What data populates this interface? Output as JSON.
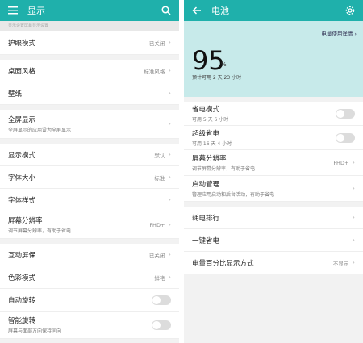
{
  "left": {
    "title": "显示",
    "strip_text": "显示设置屏幕显示设置",
    "items": [
      {
        "label": "护眼模式",
        "value": "已关闭",
        "type": "chevron"
      },
      {
        "label": "桌面风格",
        "value": "标准风格",
        "type": "chevron"
      },
      {
        "label": "壁纸",
        "value": "",
        "type": "chevron"
      },
      {
        "label": "全屏显示",
        "sub": "全屏显示的应用设为全屏显示",
        "value": "",
        "type": "chevron"
      },
      {
        "label": "显示模式",
        "value": "默认",
        "type": "chevron"
      },
      {
        "label": "字体大小",
        "value": "标准",
        "type": "chevron"
      },
      {
        "label": "字体样式",
        "value": "",
        "type": "chevron"
      },
      {
        "label": "屏幕分辨率",
        "sub": "调节屏幕分辨率，有助于省电",
        "value": "FHD+",
        "type": "chevron"
      },
      {
        "label": "互动屏保",
        "value": "已关闭",
        "type": "chevron"
      },
      {
        "label": "色彩模式",
        "value": "鲜艳",
        "type": "chevron"
      },
      {
        "label": "自动旋转",
        "value": "",
        "type": "toggle"
      },
      {
        "label": "智能旋转",
        "sub": "屏幕与面部方向保持同向",
        "value": "",
        "type": "toggle"
      }
    ]
  },
  "right": {
    "title": "电池",
    "usage_link": "电量使用详情",
    "percent": "95",
    "percent_sign": "%",
    "estimate": "预计可用 2 天 23 小时",
    "items": [
      {
        "label": "省电模式",
        "sub": "可用 5 天 6 小时",
        "value": "",
        "type": "toggle"
      },
      {
        "label": "超级省电",
        "sub": "可用 16 天 4 小时",
        "value": "",
        "type": "toggle"
      },
      {
        "label": "屏幕分辨率",
        "sub": "调节屏幕分辨率，有助于省电",
        "value": "FHD+",
        "type": "chevron"
      },
      {
        "label": "启动管理",
        "sub": "管理应用启动和后台活动，有助于省电",
        "value": "",
        "type": "chevron"
      },
      {
        "label": "耗电排行",
        "value": "",
        "type": "chevron"
      },
      {
        "label": "一键省电",
        "value": "",
        "type": "chevron"
      },
      {
        "label": "电量百分比显示方式",
        "value": "不显示",
        "type": "chevron"
      }
    ]
  },
  "colors": {
    "accent": "#1fb0ab",
    "battery_bg": "#c7eaea"
  },
  "icons": {
    "menu": "menu-icon",
    "search": "search-icon",
    "back": "back-arrow-icon",
    "settings": "gear-icon"
  }
}
